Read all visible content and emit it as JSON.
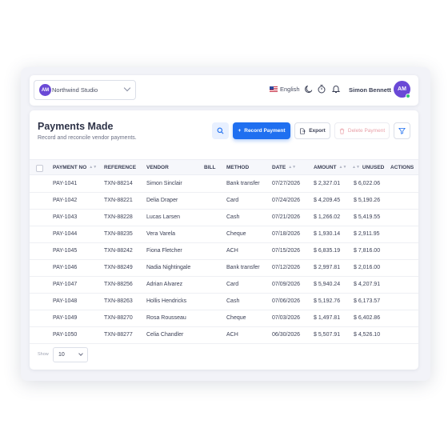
{
  "workspace": {
    "initials": "AM",
    "name": "Northwind Studio"
  },
  "header": {
    "language": "English",
    "user_name": "Simon Bennett",
    "user_initials": "AM"
  },
  "page": {
    "title": "Payments Made",
    "subtitle": "Record and reconcile vendor payments."
  },
  "toolbar": {
    "record_label": "Record Payment",
    "export_label": "Export",
    "delete_label": "Delete Payment"
  },
  "table": {
    "columns": [
      "PAYMENT NO",
      "REFERENCE",
      "VENDOR",
      "BILL",
      "METHOD",
      "DATE",
      "AMOUNT",
      "UNUSED",
      "ACTIONS"
    ],
    "rows": [
      {
        "payment_no": "PAY-1041",
        "reference": "TXN-88214",
        "vendor": "Simon Sinclair",
        "method": "Bank transfer",
        "date": "07/27/2026",
        "amount": "$ 2,327.01",
        "unused": "$ 6,022.06"
      },
      {
        "payment_no": "PAY-1042",
        "reference": "TXN-88221",
        "vendor": "Delia Draper",
        "method": "Card",
        "date": "07/24/2026",
        "amount": "$ 4,209.45",
        "unused": "$ 5,190.26"
      },
      {
        "payment_no": "PAY-1043",
        "reference": "TXN-88228",
        "vendor": "Lucas Larsen",
        "method": "Cash",
        "date": "07/21/2026",
        "amount": "$ 1,266.02",
        "unused": "$ 5,419.55"
      },
      {
        "payment_no": "PAY-1044",
        "reference": "TXN-88235",
        "vendor": "Vera Varela",
        "method": "Cheque",
        "date": "07/18/2026",
        "amount": "$ 1,930.14",
        "unused": "$ 2,911.95"
      },
      {
        "payment_no": "PAY-1045",
        "reference": "TXN-88242",
        "vendor": "Fiona Fletcher",
        "method": "ACH",
        "date": "07/15/2026",
        "amount": "$ 6,835.19",
        "unused": "$ 7,816.00"
      },
      {
        "payment_no": "PAY-1046",
        "reference": "TXN-88249",
        "vendor": "Nadia Nightingale",
        "method": "Bank transfer",
        "date": "07/12/2026",
        "amount": "$ 2,997.81",
        "unused": "$ 2,016.00"
      },
      {
        "payment_no": "PAY-1047",
        "reference": "TXN-88256",
        "vendor": "Adrian Alvarez",
        "method": "Card",
        "date": "07/09/2026",
        "amount": "$ 5,940.24",
        "unused": "$ 4,207.91"
      },
      {
        "payment_no": "PAY-1048",
        "reference": "TXN-88263",
        "vendor": "Hollis Hendricks",
        "method": "Cash",
        "date": "07/06/2026",
        "amount": "$ 5,192.76",
        "unused": "$ 6,173.57"
      },
      {
        "payment_no": "PAY-1049",
        "reference": "TXN-88270",
        "vendor": "Rosa Rousseau",
        "method": "Cheque",
        "date": "07/03/2026",
        "amount": "$ 1,497.81",
        "unused": "$ 6,402.86"
      },
      {
        "payment_no": "PAY-1050",
        "reference": "TXN-88277",
        "vendor": "Celia Chandler",
        "method": "ACH",
        "date": "06/30/2026",
        "amount": "$ 5,507.91",
        "unused": "$ 4,526.10"
      }
    ]
  },
  "footer": {
    "show_label": "Show",
    "page_size": "10"
  },
  "colors": {
    "accent": "#1f6ff0",
    "avatar": "#6a49d6",
    "danger_muted": "#e9a0a8",
    "online": "#34c474"
  },
  "icons": {
    "search": "search-icon",
    "record": "plus-icon",
    "export": "export-icon",
    "delete": "trash-icon",
    "filter": "filter-icon",
    "theme": "moon-icon",
    "timer": "stopwatch-icon",
    "notifications": "bell-icon"
  }
}
